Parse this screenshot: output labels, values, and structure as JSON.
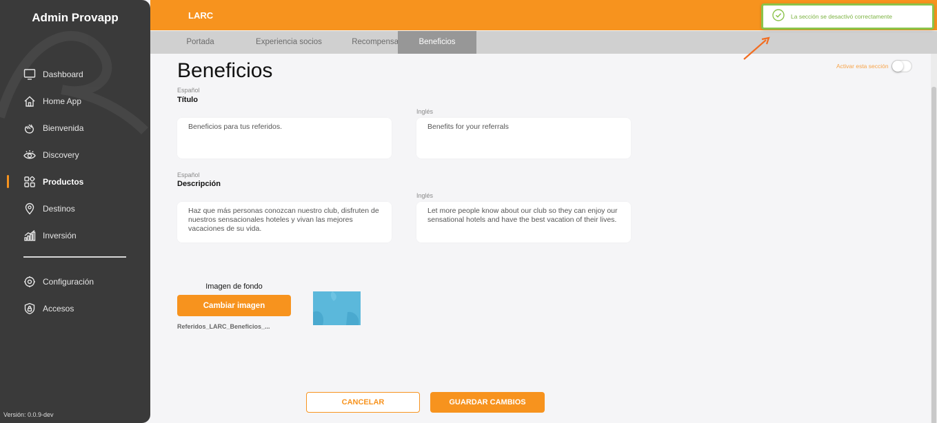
{
  "sidebar": {
    "brand": "Admin Provapp",
    "items": [
      {
        "label": "Dashboard",
        "icon": "monitor-icon"
      },
      {
        "label": "Home App",
        "icon": "home-icon"
      },
      {
        "label": "Bienvenida",
        "icon": "waving-hand-icon"
      },
      {
        "label": "Discovery",
        "icon": "eye-icon"
      },
      {
        "label": "Productos",
        "icon": "grid-icon",
        "active": true
      },
      {
        "label": "Destinos",
        "icon": "location-pin-icon"
      },
      {
        "label": "Inversión",
        "icon": "bar-chart-icon"
      }
    ],
    "secondary": [
      {
        "label": "Configuración",
        "icon": "gear-icon"
      },
      {
        "label": "Accesos",
        "icon": "shield-lock-icon"
      }
    ],
    "version": "Versión: 0.0.9-dev"
  },
  "header": {
    "title": "LARC"
  },
  "tabs": [
    {
      "label": "Portada"
    },
    {
      "label": "Experiencia socios"
    },
    {
      "label": "Recompensas"
    },
    {
      "label": "Beneficios",
      "active": true
    }
  ],
  "toast": {
    "message": "La sección se desactivó correctamente",
    "icon": "check-circle-icon",
    "color": "#8bc34a"
  },
  "main": {
    "title": "Beneficios",
    "toggle_label": "Activar esta sección",
    "toggle_on": false,
    "titulo": {
      "lang_es": "Español",
      "label": "Título",
      "lang_en": "Inglés",
      "value_es": "Beneficios para tus referidos.",
      "value_en": "Benefits for your referrals"
    },
    "descripcion": {
      "lang_es": "Español",
      "label": "Descripción",
      "lang_en": "Inglés",
      "value_es": "Haz que más personas conozcan nuestro club, disfruten de nuestros sensacionales hoteles y vivan las mejores vacaciones de su vida.",
      "value_en": "Let more people know about our club so they can enjoy our sensational hotels and have the best vacation of their lives."
    },
    "image": {
      "label": "Imagen de fondo",
      "button": "Cambiar imagen",
      "filename": "Referidos_LARC_Beneficios_..."
    },
    "cancel_label": "CANCELAR",
    "save_label": "GUARDAR CAMBIOS"
  },
  "colors": {
    "accent": "#f7931e",
    "sidebar": "#3a3a3a",
    "success": "#8bc34a"
  }
}
